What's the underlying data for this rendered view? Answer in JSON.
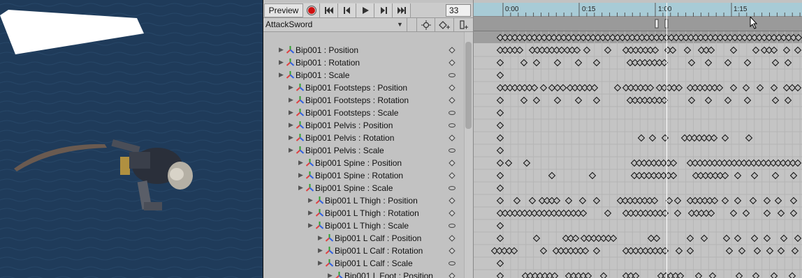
{
  "toolbar": {
    "preview_label": "Preview",
    "frame_value": "33"
  },
  "clip": {
    "name": "AttackSword"
  },
  "timeline": {
    "ruler_labels": [
      "0:00",
      "0:15",
      "1:00",
      "1:15"
    ]
  },
  "properties": [
    {
      "label": "Bip001 : Position",
      "depth": 0,
      "key": "diamond"
    },
    {
      "label": "Bip001 : Rotation",
      "depth": 0,
      "key": "diamond"
    },
    {
      "label": "Bip001 : Scale",
      "depth": 0,
      "key": "oval"
    },
    {
      "label": "Bip001 Footsteps : Position",
      "depth": 1,
      "key": "diamond"
    },
    {
      "label": "Bip001 Footsteps : Rotation",
      "depth": 1,
      "key": "diamond"
    },
    {
      "label": "Bip001 Footsteps : Scale",
      "depth": 1,
      "key": "oval"
    },
    {
      "label": "Bip001 Pelvis : Position",
      "depth": 1,
      "key": "oval"
    },
    {
      "label": "Bip001 Pelvis : Rotation",
      "depth": 1,
      "key": "diamond"
    },
    {
      "label": "Bip001 Pelvis : Scale",
      "depth": 1,
      "key": "oval"
    },
    {
      "label": "Bip001 Spine : Position",
      "depth": 2,
      "key": "diamond"
    },
    {
      "label": "Bip001 Spine : Rotation",
      "depth": 2,
      "key": "diamond"
    },
    {
      "label": "Bip001 Spine : Scale",
      "depth": 2,
      "key": "oval"
    },
    {
      "label": "Bip001 L Thigh : Position",
      "depth": 3,
      "key": "diamond"
    },
    {
      "label": "Bip001 L Thigh : Rotation",
      "depth": 3,
      "key": "diamond"
    },
    {
      "label": "Bip001 L Thigh : Scale",
      "depth": 3,
      "key": "oval"
    },
    {
      "label": "Bip001 L Calf : Position",
      "depth": 4,
      "key": "diamond"
    },
    {
      "label": "Bip001 L Calf : Rotation",
      "depth": 4,
      "key": "diamond"
    },
    {
      "label": "Bip001 L Calf : Scale",
      "depth": 4,
      "key": "oval"
    },
    {
      "label": "Bip001 L Foot : Position",
      "depth": 5,
      "key": "diamond"
    }
  ],
  "colors": {
    "scene_bg": "#1f3b5a",
    "ruler_bg": "#a8cbd6",
    "record_red": "#d01010",
    "axis_red": "#e04040",
    "axis_green": "#30a030",
    "axis_blue": "#3060e0"
  },
  "icons": {
    "record": "record-icon",
    "first_key": "first-key-icon",
    "prev_key": "prev-key-icon",
    "play": "play-icon",
    "next_key": "next-key-icon",
    "last_key": "last-key-icon",
    "add_keyframe": "add-keyframe-icon",
    "add_event": "add-event-icon",
    "filter": "key-filter-icon",
    "transform": "transform-icon"
  }
}
